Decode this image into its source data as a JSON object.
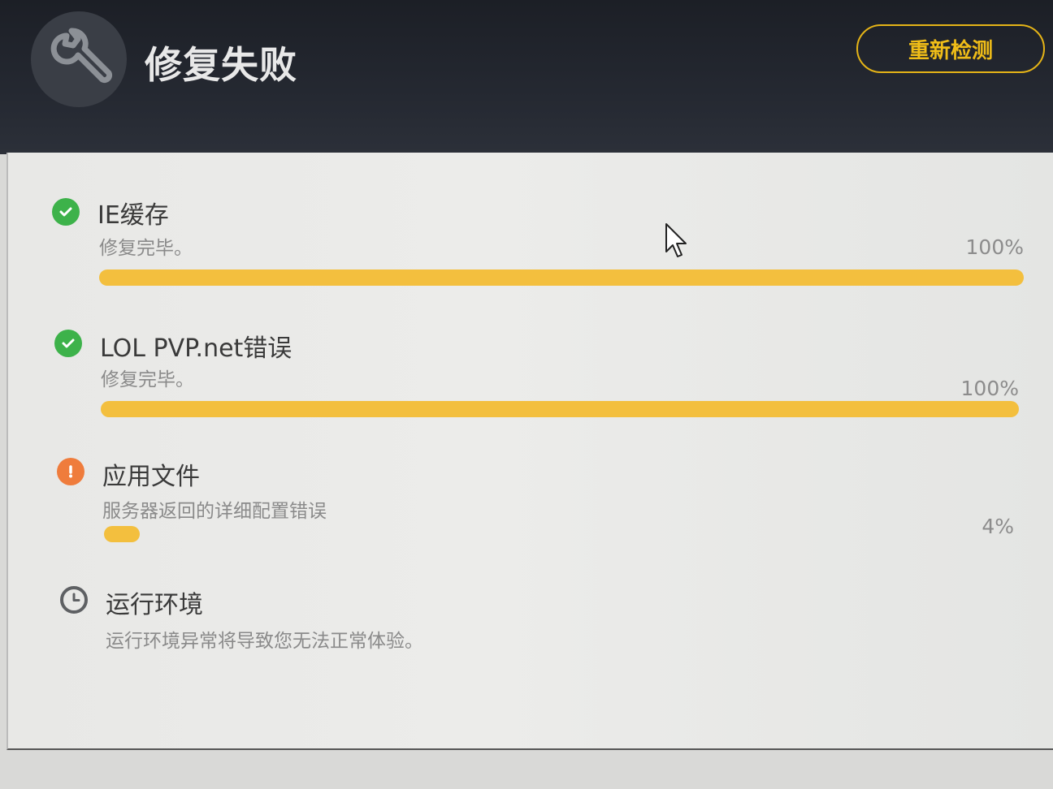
{
  "header": {
    "title": "修复失败",
    "recheck_label": "重新检测",
    "icon": "wrench-icon"
  },
  "items": [
    {
      "title": "IE缓存",
      "desc": "修复完毕。",
      "percent_label": "100%",
      "progress": 1.0,
      "status": "success",
      "status_icon": "check-circle-icon"
    },
    {
      "title": "LOL PVP.net错误",
      "desc": "修复完毕。",
      "percent_label": "100%",
      "progress": 1.0,
      "status": "success",
      "status_icon": "check-circle-icon"
    },
    {
      "title": "应用文件",
      "desc": "服务器返回的详细配置错误",
      "percent_label": "4%",
      "progress": 0.04,
      "status": "warning",
      "status_icon": "exclamation-circle-icon"
    },
    {
      "title": "运行环境",
      "desc": "运行环境异常将导致您无法正常体验。",
      "status": "pending",
      "status_icon": "clock-icon"
    }
  ],
  "colors": {
    "accent": "#f0bd18",
    "progress": "#f3bf3e",
    "success": "#3db24a",
    "warning": "#ef7c3c"
  }
}
